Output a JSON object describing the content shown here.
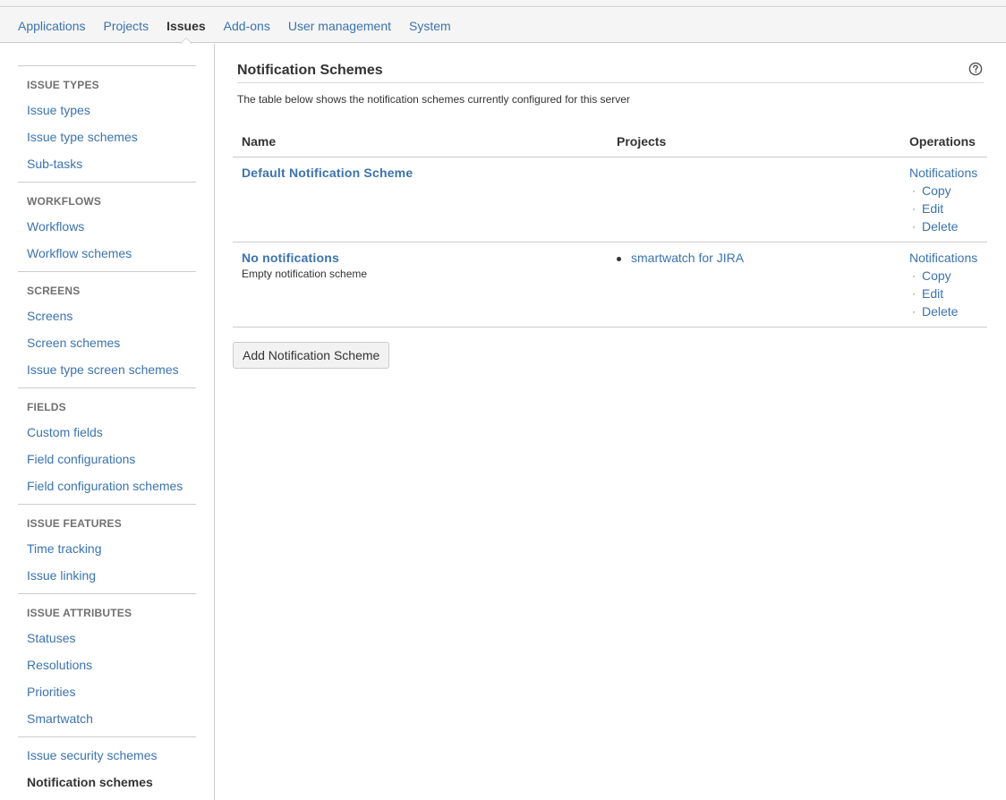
{
  "topnav": {
    "items": [
      {
        "label": "Applications",
        "active": false
      },
      {
        "label": "Projects",
        "active": false
      },
      {
        "label": "Issues",
        "active": true
      },
      {
        "label": "Add-ons",
        "active": false
      },
      {
        "label": "User management",
        "active": false
      },
      {
        "label": "System",
        "active": false
      }
    ]
  },
  "sidebar": {
    "sections": [
      {
        "heading": "ISSUE TYPES",
        "links": [
          "Issue types",
          "Issue type schemes",
          "Sub-tasks"
        ]
      },
      {
        "heading": "WORKFLOWS",
        "links": [
          "Workflows",
          "Workflow schemes"
        ]
      },
      {
        "heading": "SCREENS",
        "links": [
          "Screens",
          "Screen schemes",
          "Issue type screen schemes"
        ]
      },
      {
        "heading": "FIELDS",
        "links": [
          "Custom fields",
          "Field configurations",
          "Field configuration schemes"
        ]
      },
      {
        "heading": "ISSUE FEATURES",
        "links": [
          "Time tracking",
          "Issue linking"
        ]
      },
      {
        "heading": "ISSUE ATTRIBUTES",
        "links": [
          "Statuses",
          "Resolutions",
          "Priorities",
          "Smartwatch"
        ]
      },
      {
        "heading": "",
        "links": [
          "Issue security schemes",
          "Notification schemes"
        ]
      }
    ],
    "current": "Notification schemes"
  },
  "main": {
    "title": "Notification Schemes",
    "description": "The table below shows the notification schemes currently configured for this server",
    "help_icon": "question-circle-icon",
    "table": {
      "headers": {
        "name": "Name",
        "projects": "Projects",
        "operations": "Operations"
      },
      "rows": [
        {
          "name": "Default Notification Scheme",
          "description": "",
          "projects": [],
          "operations": [
            "Notifications",
            "Copy",
            "Edit",
            "Delete"
          ]
        },
        {
          "name": "No notifications",
          "description": "Empty notification scheme",
          "projects": [
            "smartwatch for JIRA"
          ],
          "operations": [
            "Notifications",
            "Copy",
            "Edit",
            "Delete"
          ]
        }
      ]
    },
    "add_button": "Add Notification Scheme"
  },
  "colors": {
    "link": "#3b73af",
    "text": "#333333",
    "heading_muted": "#707070",
    "border": "#cccccc",
    "nav_bg": "#f5f5f5"
  }
}
